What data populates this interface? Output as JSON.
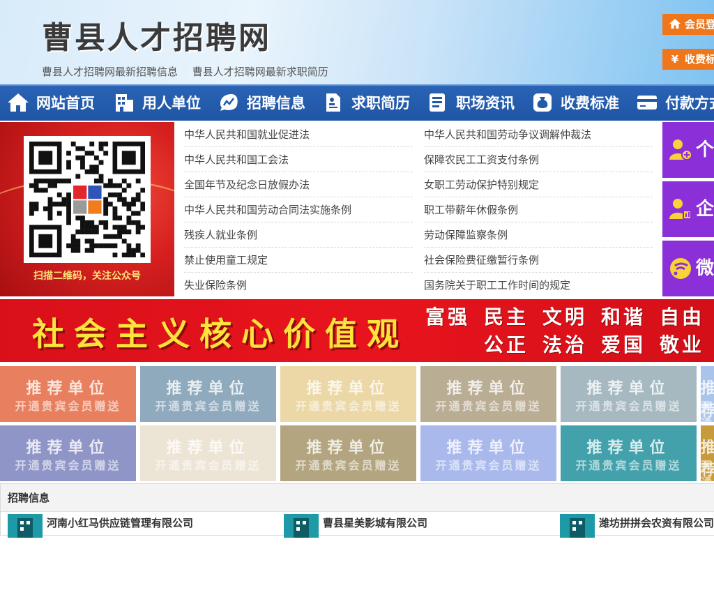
{
  "header": {
    "site_title": "曹县人才招聘网",
    "sub_links": [
      "曹县人才招聘网最新招聘信息",
      "曹县人才招聘网最新求职简历"
    ],
    "login_button": "会员登",
    "fee_button": "收费标",
    "fee_symbol": "¥"
  },
  "nav": {
    "items": [
      {
        "label": "网站首页",
        "icon": "home-icon"
      },
      {
        "label": "用人单位",
        "icon": "building-icon"
      },
      {
        "label": "招聘信息",
        "icon": "chart-icon"
      },
      {
        "label": "求职简历",
        "icon": "resume-icon"
      },
      {
        "label": "职场资讯",
        "icon": "news-icon"
      },
      {
        "label": "收费标准",
        "icon": "money-bag-icon"
      },
      {
        "label": "付款方式",
        "icon": "card-icon"
      }
    ]
  },
  "qr": {
    "caption": "扫描二维码，关注公众号"
  },
  "laws": [
    [
      "中华人民共和国就业促进法",
      "中华人民共和国劳动争议调解仲裁法"
    ],
    [
      "中华人民共和国工会法",
      "保障农民工工资支付条例"
    ],
    [
      "全国年节及纪念日放假办法",
      "女职工劳动保护特别规定"
    ],
    [
      "中华人民共和国劳动合同法实施条例",
      "职工带薪年休假条例"
    ],
    [
      "残疾人就业条例",
      "劳动保障监察条例"
    ],
    [
      "禁止使用童工规定",
      "社会保险费征缴暂行条例"
    ],
    [
      "失业保险条例",
      "国务院关于职工工作时间的规定"
    ]
  ],
  "side_buttons": [
    {
      "label": "个",
      "icon": "person-add-icon"
    },
    {
      "label": "企",
      "icon": "company-user-icon"
    },
    {
      "label": "微",
      "icon": "wechat-icon"
    }
  ],
  "banner": {
    "title": "社会主义核心价值观",
    "row1": [
      "富强",
      "民主",
      "文明",
      "和谐",
      "自由"
    ],
    "row2": [
      "公正",
      "法治",
      "爱国",
      "敬业"
    ]
  },
  "tiles": {
    "line1": "推荐单位",
    "line2": "开通贵宾会员赠送",
    "colors_row1": [
      "#e8805f",
      "#8faabd",
      "#ecd7a6",
      "#b9ad94",
      "#a6b9c0",
      "#a9c3ea"
    ],
    "colors_row2": [
      "#8f96c7",
      "#ece4d4",
      "#b2a57f",
      "#a9b9ec",
      "#43a1ab",
      "#c79a3c"
    ]
  },
  "recruit": {
    "title": "招聘信息",
    "companies": [
      "河南小红马供应链管理有限公司",
      "曹县星美影城有限公司",
      "潍坊拼拼会农资有限公司"
    ]
  }
}
